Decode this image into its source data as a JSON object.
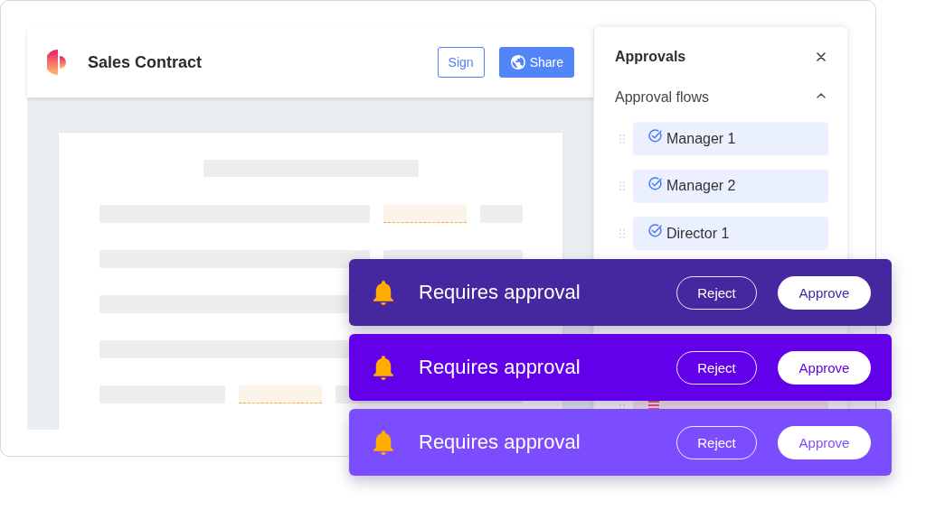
{
  "header": {
    "title": "Sales Contract",
    "buttons": [
      {
        "label": "Sign",
        "kind": "outline"
      },
      {
        "label": "Share",
        "kind": "primary"
      }
    ]
  },
  "panel": {
    "title": "Approvals",
    "section": {
      "title": "Approval flows",
      "expanded": true
    },
    "approvers": [
      {
        "name": "Manager 1",
        "approved": true
      },
      {
        "name": "Manager 2",
        "approved": true
      },
      {
        "name": "Director 1",
        "approved": true
      }
    ]
  },
  "banners": [
    {
      "message": "Requires approval",
      "color": "#4527a0",
      "actions": [
        {
          "label": "Reject",
          "kind": "outline"
        },
        {
          "label": "Approve",
          "kind": "filled"
        }
      ]
    },
    {
      "message": "Requires approval",
      "color": "#6200ea",
      "actions": [
        {
          "label": "Reject",
          "kind": "outline"
        },
        {
          "label": "Approve",
          "kind": "filled"
        }
      ]
    },
    {
      "message": "Requires approval",
      "color": "#7c4dff",
      "actions": [
        {
          "label": "Reject",
          "kind": "outline"
        },
        {
          "label": "Approve",
          "kind": "filled"
        }
      ]
    }
  ]
}
